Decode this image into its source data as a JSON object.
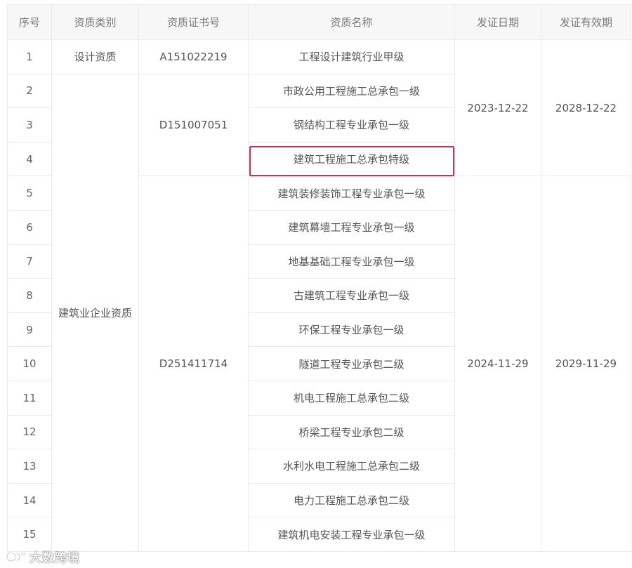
{
  "table": {
    "headers": [
      "序号",
      "资质类别",
      "资质证书号",
      "资质名称",
      "发证日期",
      "发证有效期"
    ],
    "categories": {
      "design": "设计资质",
      "construction": "建筑业企业资质"
    },
    "certificates": {
      "a": "A151022219",
      "b": "D151007051",
      "c": "D251411714"
    },
    "dates": {
      "issue_1": "2023-12-22",
      "expire_1": "2028-12-22",
      "issue_2": "2024-11-29",
      "expire_2": "2029-11-29"
    },
    "rows": [
      {
        "no": "1",
        "name": "工程设计建筑行业甲级"
      },
      {
        "no": "2",
        "name": "市政公用工程施工总承包一级"
      },
      {
        "no": "3",
        "name": "钢结构工程专业承包一级"
      },
      {
        "no": "4",
        "name": "建筑工程施工总承包特级"
      },
      {
        "no": "5",
        "name": "建筑装修装饰工程专业承包一级"
      },
      {
        "no": "6",
        "name": "建筑幕墙工程专业承包一级"
      },
      {
        "no": "7",
        "name": "地基基础工程专业承包一级"
      },
      {
        "no": "8",
        "name": "古建筑工程专业承包一级"
      },
      {
        "no": "9",
        "name": "环保工程专业承包一级"
      },
      {
        "no": "10",
        "name": "隧道工程专业承包二级"
      },
      {
        "no": "11",
        "name": "机电工程施工总承包二级"
      },
      {
        "no": "12",
        "name": "桥梁工程专业承包二级"
      },
      {
        "no": "13",
        "name": "水利水电工程施工总承包二级"
      },
      {
        "no": "14",
        "name": "电力工程施工总承包二级"
      },
      {
        "no": "15",
        "name": "建筑机电安装工程专业承包一级"
      }
    ]
  },
  "highlight": {
    "color": "#c8325c",
    "row_no": "4"
  },
  "watermark": {
    "text": "大数跨境",
    "icon": "brand-logo-icon"
  }
}
